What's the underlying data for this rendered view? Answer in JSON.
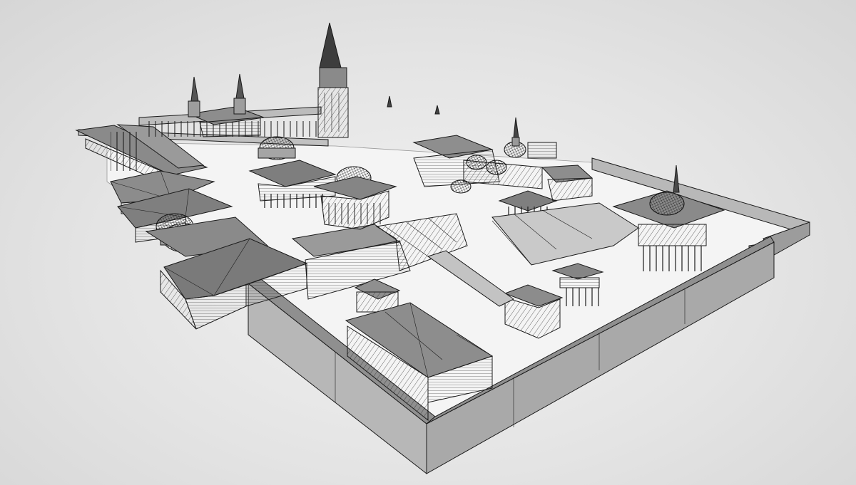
{
  "scene": {
    "subject": "wireframe-3d-model",
    "render_style": "grey-shaded-wireframe",
    "colors": {
      "background": "#e6e6e6",
      "ground": "#efefef",
      "wall_light": "#bdbdbd",
      "wall_mid": "#a5a5a5",
      "wall_dark": "#8e8e8e",
      "roof": "#9a9a9a",
      "roof_dark": "#7d7d7d",
      "edge": "#1a1a1a"
    }
  }
}
